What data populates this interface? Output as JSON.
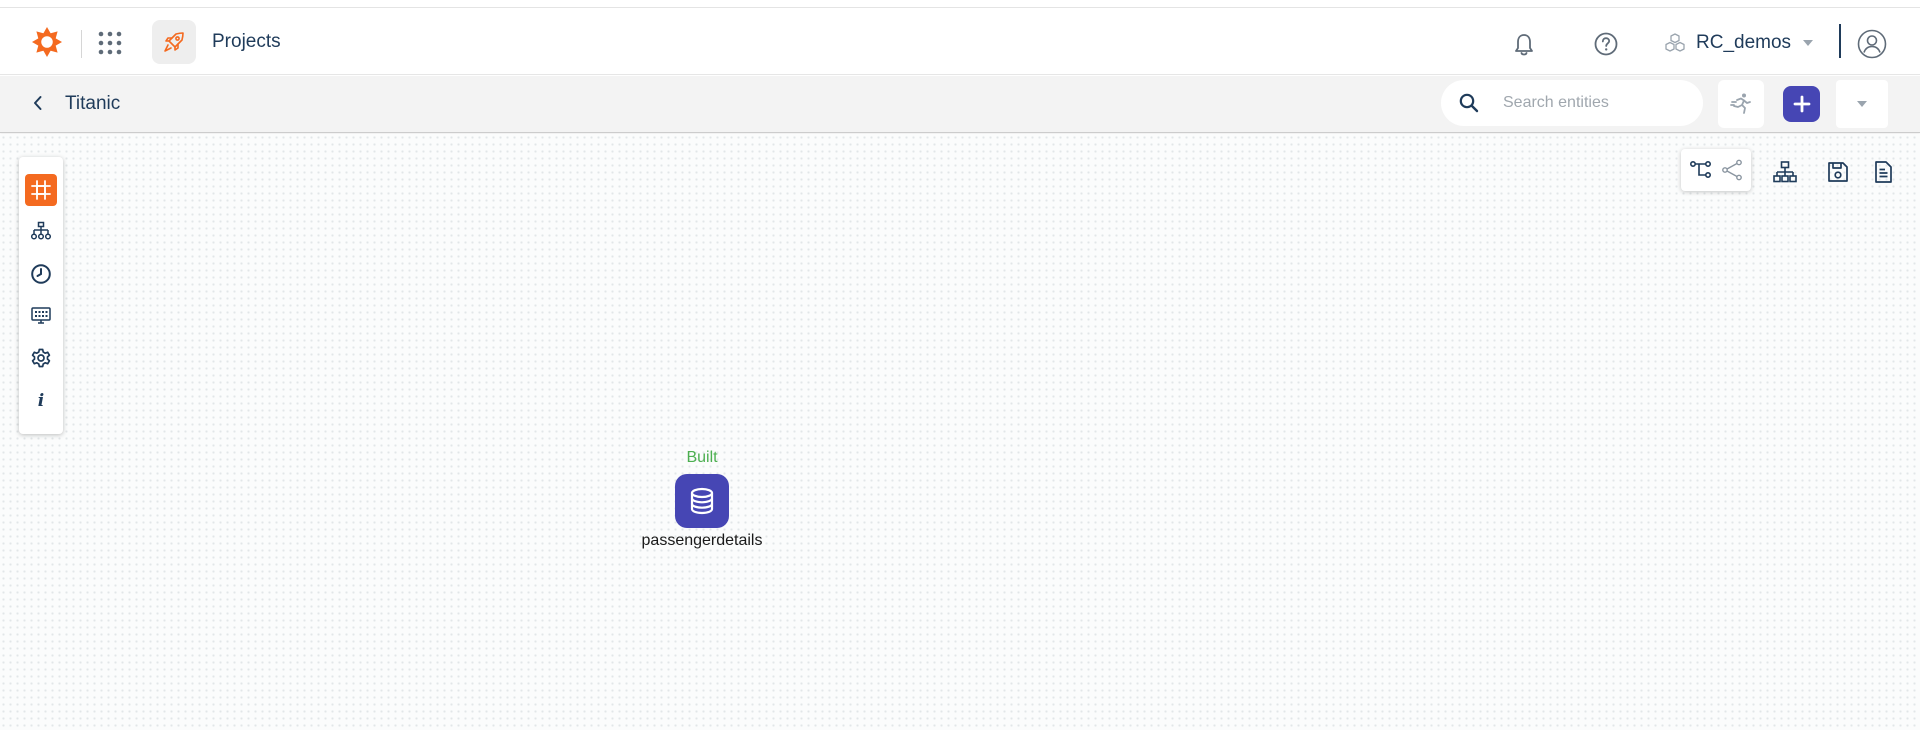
{
  "header": {
    "section_label": "Projects",
    "workspace_name": "RC_demos"
  },
  "subheader": {
    "breadcrumb": "Titanic",
    "search_placeholder": "Search entities"
  },
  "node": {
    "status": "Built",
    "name": "passengerdetails",
    "icon": "database-icon"
  },
  "left_toolbar": [
    "canvas-icon",
    "hierarchy-icon",
    "clock-icon",
    "dashboard-icon",
    "gear-icon",
    "info-icon"
  ],
  "right_toolbar": [
    "tree-view-icon",
    "graph-view-icon",
    "layout-icon",
    "save-icon",
    "notes-icon"
  ],
  "colors": {
    "brand_orange": "#f46a20",
    "primary": "#4646b4",
    "status_built": "#4caf50",
    "text_dark": "#1f3b5a"
  }
}
